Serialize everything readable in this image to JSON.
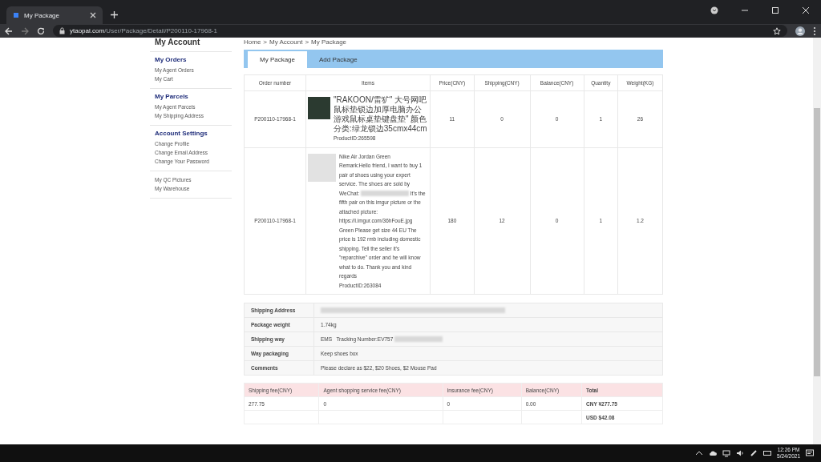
{
  "browser": {
    "tab_title": "My Package",
    "url_domain": "ytaopal.com",
    "url_path": "/User/Package/Detail/P200110-17968-1"
  },
  "sidebar": {
    "title": "My Account",
    "sections": [
      {
        "heading": "My Orders",
        "items": [
          "My Agent Orders",
          "My Cart"
        ]
      },
      {
        "heading": "My Parcels",
        "items": [
          "My Agent Parcels",
          "My Shipping Address"
        ]
      },
      {
        "heading": "Account Settings",
        "items": [
          "Change Profile",
          "Change Email Address",
          "Change Your Password"
        ]
      },
      {
        "items": [
          "My QC Pictures",
          "My Warehouse"
        ]
      }
    ]
  },
  "breadcrumb": {
    "items": [
      "Home",
      "My Account",
      "My Package"
    ],
    "separator": ">"
  },
  "tabs": [
    {
      "label": "My Package",
      "selected": true
    },
    {
      "label": "Add Package",
      "selected": false
    }
  ],
  "items_table": {
    "columns": [
      "Order number",
      "Items",
      "Price(CNY)",
      "Shipping(CNY)",
      "Balance(CNY)",
      "Quantity",
      "Weight(KG)"
    ],
    "rows": [
      {
        "order_number": "P200110-17968-1",
        "kind": "photo",
        "title": "\"RAKOON/雷犷\" 大号网吧鼠标垫锁边加厚电脑办公游戏鼠标桌垫键盘垫\" 颜色分类:绿龙锁边35cmx44cm",
        "product_id": "ProductID:265598",
        "price": "11",
        "shipping": "0",
        "balance": "0",
        "quantity": "1",
        "weight": "26"
      },
      {
        "order_number": "P200110-17968-1",
        "kind": "empty",
        "title": "Nike Air Jordan Green",
        "remark_before": "Remark:Hello friend, I want to buy 1 pair of shoes using your expert service. The shoes are sold by WeChat:",
        "remark_after": "It's the fifth pair on this imgur picture or the attached picture: https://i.imgur.com/36hFouE.jpg Green Please get size 44 EU The price is 192 rmb including domestic shipping. Tell the seller it's \"reparchive\" order and he will know what to do. Thank you and kind regards",
        "product_id": "ProductID:263084",
        "price": "180",
        "shipping": "12",
        "balance": "0",
        "quantity": "1",
        "weight": "1.2"
      }
    ]
  },
  "details": [
    {
      "label": "Shipping Address",
      "redacted": true
    },
    {
      "label": "Package weight",
      "value": "1.74kg",
      "redacted": false
    },
    {
      "label": "Shipping way",
      "value": "EMS   Tracking Number:EV757",
      "redacted": true
    },
    {
      "label": "Way packaging",
      "value": "Keep shoes box",
      "redacted": false
    },
    {
      "label": "Comments",
      "value": "Please declare as $22, $20 Shoes, $2 Mouse Pad",
      "redacted": false
    }
  ],
  "fees": {
    "columns": [
      "Shipping fee(CNY)",
      "Agent shopping service fee(CNY)",
      "Insurance fee(CNY)",
      "Balance(CNY)",
      "Total"
    ],
    "rows": [
      {
        "values": [
          "277.75",
          "0",
          "0",
          "0.00"
        ],
        "total": "CNY ¥277.75"
      },
      {
        "total": "USD $42.08"
      }
    ]
  },
  "taskbar": {
    "time": "12:26 PM",
    "date": "5/24/2021"
  }
}
